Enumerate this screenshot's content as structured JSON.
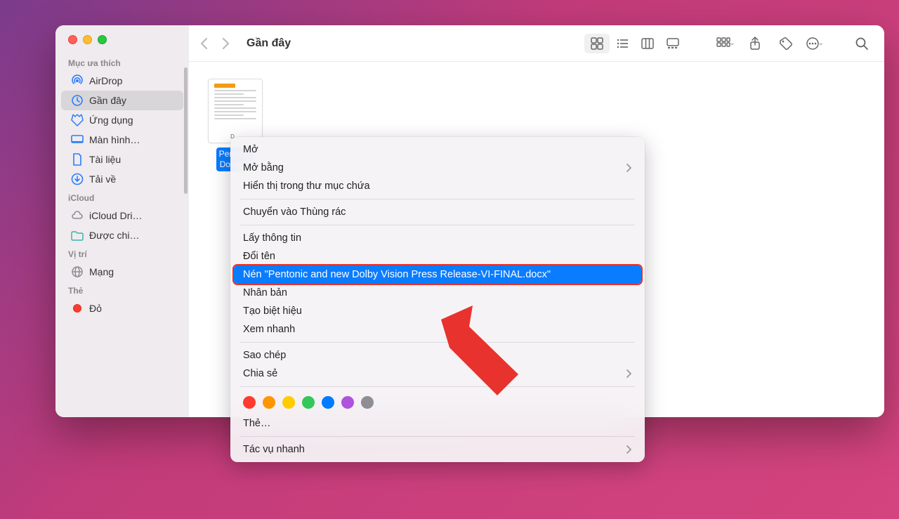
{
  "window": {
    "title": "Gần đây"
  },
  "sidebar": {
    "sections": [
      {
        "header": "Mục ưa thích",
        "items": [
          {
            "icon": "airdrop",
            "label": "AirDrop"
          },
          {
            "icon": "clock",
            "label": "Gần đây",
            "selected": true
          },
          {
            "icon": "apps",
            "label": "Ứng dụng"
          },
          {
            "icon": "desktop",
            "label": "Màn hình…"
          },
          {
            "icon": "doc",
            "label": "Tài liệu"
          },
          {
            "icon": "download",
            "label": "Tải về"
          }
        ]
      },
      {
        "header": "iCloud",
        "items": [
          {
            "icon": "cloud",
            "label": "iCloud Dri…"
          },
          {
            "icon": "shared",
            "label": "Được chi…"
          }
        ]
      },
      {
        "header": "Vị trí",
        "items": [
          {
            "icon": "network",
            "label": "Mạng"
          }
        ]
      },
      {
        "header": "Thẻ",
        "items": [
          {
            "icon": "tag-red",
            "label": "Đỏ"
          }
        ]
      }
    ]
  },
  "file": {
    "name_line1": "Pentonic",
    "name_line2": "Dolby Vi",
    "badge": "D…"
  },
  "context_menu": {
    "items": [
      {
        "label": "Mở"
      },
      {
        "label": "Mở bằng",
        "submenu": true
      },
      {
        "label": "Hiển thị trong thư mục chứa"
      },
      {
        "sep": true
      },
      {
        "label": "Chuyển vào Thùng rác"
      },
      {
        "sep": true
      },
      {
        "label": "Lấy thông tin"
      },
      {
        "label": "Đổi tên"
      },
      {
        "label": "Nén \"Pentonic and new Dolby Vision Press Release-VI-FINAL.docx\"",
        "highlighted": true
      },
      {
        "label": "Nhân bản"
      },
      {
        "label": "Tạo biệt hiệu"
      },
      {
        "label": "Xem nhanh"
      },
      {
        "sep": true
      },
      {
        "label": "Sao chép"
      },
      {
        "label": "Chia sẻ",
        "submenu": true
      },
      {
        "sep": true
      },
      {
        "tags": [
          "#ff3b30",
          "#ff9500",
          "#ffcc00",
          "#34c759",
          "#007aff",
          "#af52de",
          "#8e8e93"
        ]
      },
      {
        "label": "Thẻ…"
      },
      {
        "sep": true
      },
      {
        "label": "Tác vụ nhanh",
        "submenu": true
      }
    ]
  }
}
